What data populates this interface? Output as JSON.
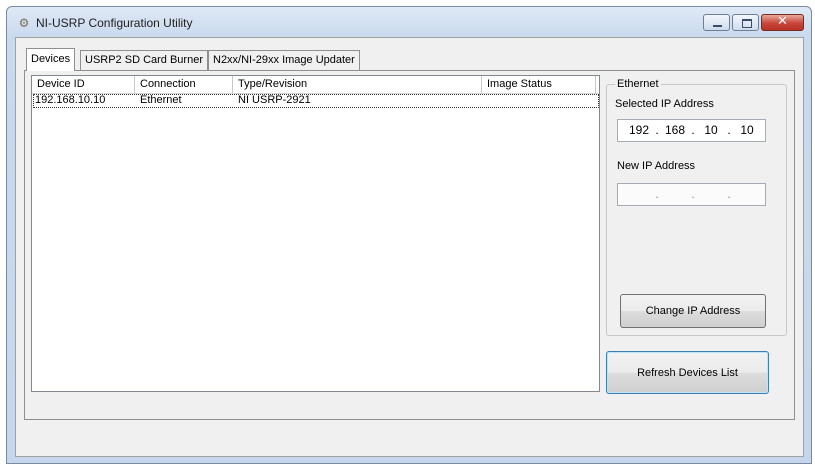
{
  "window": {
    "title": "NI-USRP Configuration Utility",
    "icon": "usrp-app-icon"
  },
  "tabs": [
    {
      "label": "Devices",
      "active": true
    },
    {
      "label": "USRP2 SD Card Burner",
      "active": false
    },
    {
      "label": "N2xx/NI-29xx Image Updater",
      "active": false
    }
  ],
  "devices": {
    "columns": [
      "Device ID",
      "Connection",
      "Type/Revision",
      "Image Status"
    ],
    "rows": [
      {
        "device_id": "192.168.10.10",
        "connection": "Ethernet",
        "type_revision": "NI USRP-2921",
        "image_status": "",
        "selected": true
      }
    ]
  },
  "ethernet": {
    "group_label": "Ethernet",
    "selected_ip_label": "Selected IP Address",
    "selected_ip": [
      "192",
      "168",
      "10",
      "10"
    ],
    "new_ip_label": "New IP Address",
    "new_ip": [
      "",
      "",
      "",
      ""
    ],
    "change_button": "Change IP Address"
  },
  "refresh_button": "Refresh Devices List",
  "colors": {
    "titlebar": "#c9d9ee",
    "close_button": "#c8453a",
    "dialog_face": "#f0f0f0",
    "default_button_border": "#3c7fb1"
  }
}
